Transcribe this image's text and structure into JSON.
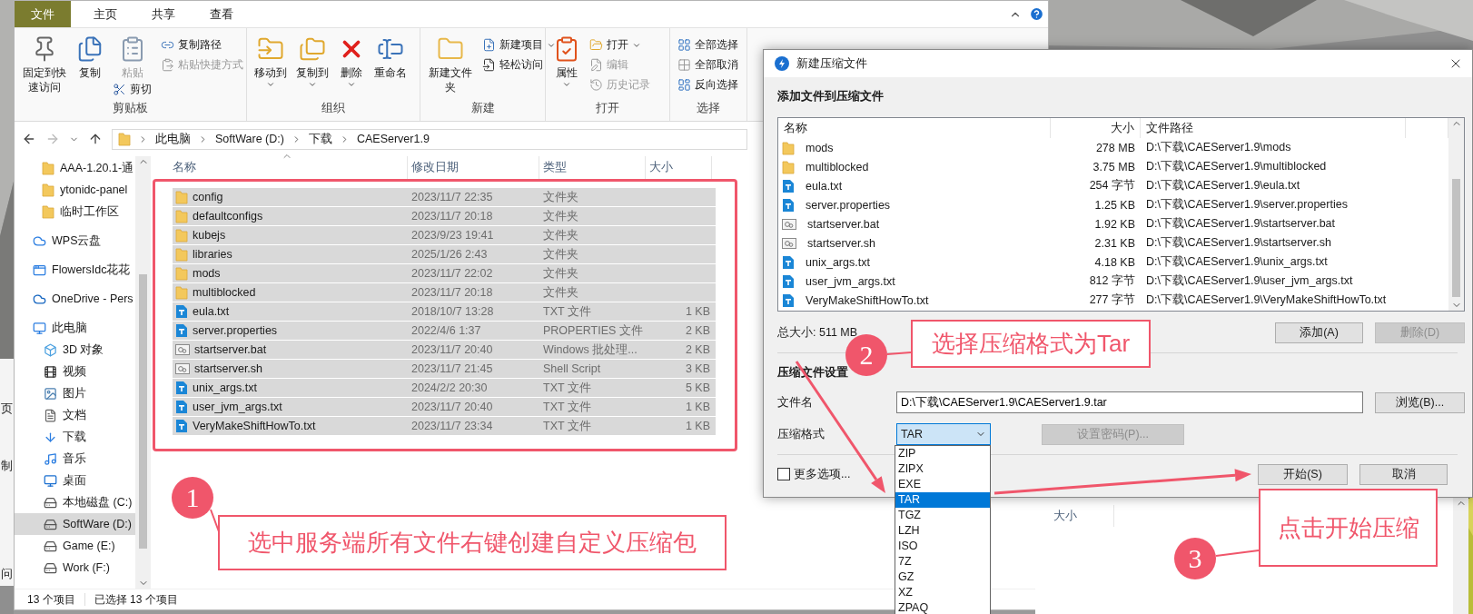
{
  "explorer": {
    "ribbon_tabs": [
      {
        "label": "文件",
        "kind": "file"
      },
      {
        "label": "主页",
        "kind": "tab"
      },
      {
        "label": "共享",
        "kind": "tab"
      },
      {
        "label": "查看",
        "kind": "tab"
      }
    ],
    "ribbon_groups": [
      {
        "label": "剪贴板",
        "items": [
          {
            "kind": "large",
            "label": "固定到快速访问",
            "disabled": false
          },
          {
            "kind": "large",
            "label": "复制",
            "disabled": false
          },
          {
            "kind": "large",
            "label": "粘贴",
            "disabled": true,
            "below": {
              "label": "剪切",
              "disabled": false
            }
          },
          {
            "kind": "stack",
            "items": [
              {
                "label": "复制路径",
                "disabled": false
              },
              {
                "label": "粘贴快捷方式",
                "disabled": true
              }
            ]
          }
        ]
      },
      {
        "label": "组织",
        "items": [
          {
            "kind": "large",
            "label": "移动到",
            "disabled": false,
            "menu": true
          },
          {
            "kind": "large",
            "label": "复制到",
            "disabled": false,
            "menu": true
          },
          {
            "kind": "large",
            "label": "删除",
            "disabled": false,
            "menu": true
          },
          {
            "kind": "large",
            "label": "重命名",
            "disabled": false
          }
        ]
      },
      {
        "label": "新建",
        "items": [
          {
            "kind": "large",
            "label": "新建文件夹",
            "disabled": false
          },
          {
            "kind": "stack",
            "items": [
              {
                "label": "新建项目",
                "disabled": false,
                "menu": true
              },
              {
                "label": "轻松访问",
                "disabled": false
              }
            ]
          }
        ]
      },
      {
        "label": "打开",
        "items": [
          {
            "kind": "large",
            "label": "属性",
            "disabled": false,
            "menu": true
          },
          {
            "kind": "stack",
            "items": [
              {
                "label": "打开",
                "disabled": false,
                "menu": true
              },
              {
                "label": "编辑",
                "disabled": true
              },
              {
                "label": "历史记录",
                "disabled": true
              }
            ]
          }
        ]
      },
      {
        "label": "选择",
        "items": [
          {
            "kind": "stack",
            "items": [
              {
                "label": "全部选择",
                "disabled": false
              },
              {
                "label": "全部取消",
                "disabled": false
              },
              {
                "label": "反向选择",
                "disabled": false
              }
            ]
          }
        ]
      }
    ],
    "address": {
      "crumbs": [
        "此电脑",
        "SoftWare (D:)",
        "下载",
        "CAEServer1.9"
      ]
    },
    "nav": {
      "sections": [
        [
          {
            "label": "AAA-1.20.1-通",
            "kind": "folder",
            "selected": false
          },
          {
            "label": "ytonidc-panel",
            "kind": "folder",
            "selected": false
          },
          {
            "label": "临时工作区",
            "kind": "folder",
            "selected": false
          }
        ],
        [
          {
            "label": "WPS云盘",
            "kind": "cloud",
            "selected": false
          }
        ],
        [
          {
            "label": "FlowersIdc花花",
            "kind": "app",
            "selected": false
          }
        ],
        [
          {
            "label": "OneDrive - Pers",
            "kind": "onedrive",
            "selected": false
          }
        ],
        [
          {
            "label": "此电脑",
            "kind": "pc",
            "selected": false,
            "children": [
              {
                "label": "3D 对象",
                "kind": "objects",
                "selected": false
              },
              {
                "label": "视频",
                "kind": "video",
                "selected": false
              },
              {
                "label": "图片",
                "kind": "pictures",
                "selected": false
              },
              {
                "label": "文档",
                "kind": "documents",
                "selected": false
              },
              {
                "label": "下载",
                "kind": "downloads",
                "selected": false
              },
              {
                "label": "音乐",
                "kind": "music",
                "selected": false
              },
              {
                "label": "桌面",
                "kind": "desktop",
                "selected": false
              },
              {
                "label": "本地磁盘 (C:)",
                "kind": "drive",
                "selected": false
              },
              {
                "label": "SoftWare (D:)",
                "kind": "drive",
                "selected": true
              },
              {
                "label": "Game (E:)",
                "kind": "drive",
                "selected": false
              },
              {
                "label": "Work (F:)",
                "kind": "drive",
                "selected": false
              }
            ]
          }
        ]
      ]
    },
    "files": {
      "columns": [
        "名称",
        "修改日期",
        "类型",
        "大小"
      ],
      "rows": [
        {
          "name": "config",
          "date": "2023/11/7 22:35",
          "type": "文件夹",
          "kind": "folder",
          "selected": true
        },
        {
          "name": "defaultconfigs",
          "date": "2023/11/7 20:18",
          "type": "文件夹",
          "kind": "folder",
          "selected": true
        },
        {
          "name": "kubejs",
          "date": "2023/9/23 19:41",
          "type": "文件夹",
          "kind": "folder",
          "selected": true
        },
        {
          "name": "libraries",
          "date": "2025/1/26 2:43",
          "type": "文件夹",
          "kind": "folder",
          "selected": true
        },
        {
          "name": "mods",
          "date": "2023/11/7 22:02",
          "type": "文件夹",
          "kind": "folder",
          "selected": true
        },
        {
          "name": "multiblocked",
          "date": "2023/11/7 20:18",
          "type": "文件夹",
          "kind": "folder",
          "selected": true
        },
        {
          "name": "eula.txt",
          "date": "2018/10/7 13:28",
          "type": "TXT 文件",
          "size": "1 KB",
          "kind": "text",
          "selected": true
        },
        {
          "name": "server.properties",
          "date": "2022/4/6 1:37",
          "type": "PROPERTIES 文件",
          "size": "2 KB",
          "kind": "text",
          "selected": true
        },
        {
          "name": "startserver.bat",
          "date": "2023/11/7 20:40",
          "type": "Windows 批处理...",
          "size": "2 KB",
          "kind": "script",
          "selected": true
        },
        {
          "name": "startserver.sh",
          "date": "2023/11/7 21:45",
          "type": "Shell Script",
          "size": "3 KB",
          "kind": "script",
          "selected": true
        },
        {
          "name": "unix_args.txt",
          "date": "2024/2/2 20:30",
          "type": "TXT 文件",
          "size": "5 KB",
          "kind": "text",
          "selected": true
        },
        {
          "name": "user_jvm_args.txt",
          "date": "2023/11/7 20:40",
          "type": "TXT 文件",
          "size": "1 KB",
          "kind": "text",
          "selected": true
        },
        {
          "name": "VeryMakeShiftHowTo.txt",
          "date": "2023/11/7 23:34",
          "type": "TXT 文件",
          "size": "1 KB",
          "kind": "text",
          "selected": true
        }
      ]
    },
    "status": [
      "13 个项目",
      "已选择 13 个项目"
    ]
  },
  "dialog": {
    "title": "新建压缩文件",
    "heading": "添加文件到压缩文件",
    "columns": [
      "名称",
      "大小",
      "文件路径"
    ],
    "rows": [
      {
        "name": "mods",
        "size": "278 MB",
        "path": "D:\\下载\\CAEServer1.9\\mods",
        "kind": "folder"
      },
      {
        "name": "multiblocked",
        "size": "3.75 MB",
        "path": "D:\\下载\\CAEServer1.9\\multiblocked",
        "kind": "folder"
      },
      {
        "name": "eula.txt",
        "size": "254 字节",
        "path": "D:\\下载\\CAEServer1.9\\eula.txt",
        "kind": "text"
      },
      {
        "name": "server.properties",
        "size": "1.25 KB",
        "path": "D:\\下载\\CAEServer1.9\\server.properties",
        "kind": "text"
      },
      {
        "name": "startserver.bat",
        "size": "1.92 KB",
        "path": "D:\\下载\\CAEServer1.9\\startserver.bat",
        "kind": "script"
      },
      {
        "name": "startserver.sh",
        "size": "2.31 KB",
        "path": "D:\\下载\\CAEServer1.9\\startserver.sh",
        "kind": "script"
      },
      {
        "name": "unix_args.txt",
        "size": "4.18 KB",
        "path": "D:\\下载\\CAEServer1.9\\unix_args.txt",
        "kind": "text"
      },
      {
        "name": "user_jvm_args.txt",
        "size": "812 字节",
        "path": "D:\\下载\\CAEServer1.9\\user_jvm_args.txt",
        "kind": "text"
      },
      {
        "name": "VeryMakeShiftHowTo.txt",
        "size": "277 字节",
        "path": "D:\\下载\\CAEServer1.9\\VeryMakeShiftHowTo.txt",
        "kind": "text"
      }
    ],
    "total": "总大小: 511 MB",
    "list_buttons": [
      {
        "label": "添加(A)",
        "disabled": false
      },
      {
        "label": "删除(D)",
        "disabled": true
      }
    ],
    "settings_heading": "压缩文件设置",
    "filename_label": "文件名",
    "filename_value": "D:\\下载\\CAEServer1.9\\CAEServer1.9.tar",
    "browse": {
      "label": "浏览(B)...",
      "disabled": false
    },
    "format_label": "压缩格式",
    "format_value": "TAR",
    "password": {
      "label": "设置密码(P)...",
      "disabled": true
    },
    "more_options": {
      "label": "更多选项...",
      "checked": false
    },
    "footer_buttons": [
      {
        "label": "开始(S)",
        "disabled": false
      },
      {
        "label": "取消",
        "disabled": false
      }
    ]
  },
  "format_dropdown": [
    {
      "label": "ZIP",
      "selected": false
    },
    {
      "label": "ZIPX",
      "selected": false
    },
    {
      "label": "EXE",
      "selected": false
    },
    {
      "label": "TAR",
      "selected": true
    },
    {
      "label": "TGZ",
      "selected": false
    },
    {
      "label": "LZH",
      "selected": false
    },
    {
      "label": "ISO",
      "selected": false
    },
    {
      "label": "7Z",
      "selected": false
    },
    {
      "label": "GZ",
      "selected": false
    },
    {
      "label": "XZ",
      "selected": false
    },
    {
      "label": "ZPAQ",
      "selected": false
    }
  ],
  "back_window": {
    "column": "大小"
  },
  "left_fragments": [
    "页",
    "制",
    "问"
  ],
  "annotations": [
    {
      "number": "1",
      "text": "选中服务端所有文件右键创建自定义压缩包"
    },
    {
      "number": "2",
      "text": "选择压缩格式为Tar"
    },
    {
      "number": "3",
      "text": "点击开始压缩"
    }
  ]
}
